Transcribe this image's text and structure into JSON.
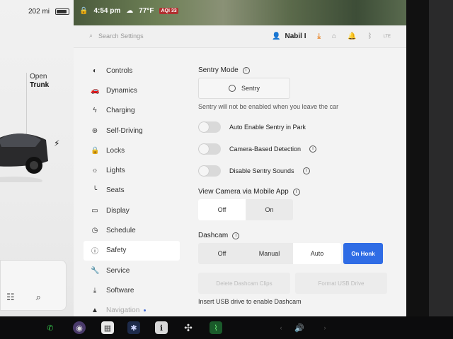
{
  "left": {
    "range": "202 mi",
    "open_label": "Open",
    "trunk_label": "Trunk"
  },
  "status": {
    "time": "4:54 pm",
    "temperature": "77°F",
    "aqi": "AQI 33"
  },
  "header": {
    "search_placeholder": "Search Settings",
    "user_name": "Nabil I",
    "lte_label": "LTE"
  },
  "nav": {
    "items": [
      {
        "label": "Controls",
        "icon": "toggle-icon"
      },
      {
        "label": "Dynamics",
        "icon": "car-icon"
      },
      {
        "label": "Charging",
        "icon": "bolt-icon"
      },
      {
        "label": "Self-Driving",
        "icon": "steering-wheel-icon"
      },
      {
        "label": "Locks",
        "icon": "lock-icon"
      },
      {
        "label": "Lights",
        "icon": "sun-icon"
      },
      {
        "label": "Seats",
        "icon": "seat-icon"
      },
      {
        "label": "Display",
        "icon": "display-icon"
      },
      {
        "label": "Schedule",
        "icon": "clock-icon"
      },
      {
        "label": "Safety",
        "icon": "info-icon"
      },
      {
        "label": "Service",
        "icon": "wrench-icon"
      },
      {
        "label": "Software",
        "icon": "download-icon"
      },
      {
        "label": "Navigation",
        "icon": "navigation-icon"
      }
    ],
    "active": "Safety"
  },
  "sentry": {
    "title": "Sentry Mode",
    "button_label": "Sentry",
    "note": "Sentry will not be enabled when you leave the car",
    "toggles": [
      {
        "label": "Auto Enable Sentry in Park",
        "on": false
      },
      {
        "label": "Camera-Based Detection",
        "on": false
      },
      {
        "label": "Disable Sentry Sounds",
        "on": false
      }
    ]
  },
  "view_camera": {
    "title": "View Camera via Mobile App",
    "options": [
      "Off",
      "On"
    ],
    "selected": "Off"
  },
  "dashcam": {
    "title": "Dashcam",
    "options": [
      "Off",
      "Manual",
      "Auto",
      "On Honk"
    ],
    "selected": "On Honk",
    "delete_label": "Delete Dashcam Clips",
    "format_label": "Format USB Drive",
    "usb_note": "Insert USB drive to enable Dashcam"
  },
  "colors": {
    "accent": "#2f6ce5",
    "download": "#e8862a"
  }
}
